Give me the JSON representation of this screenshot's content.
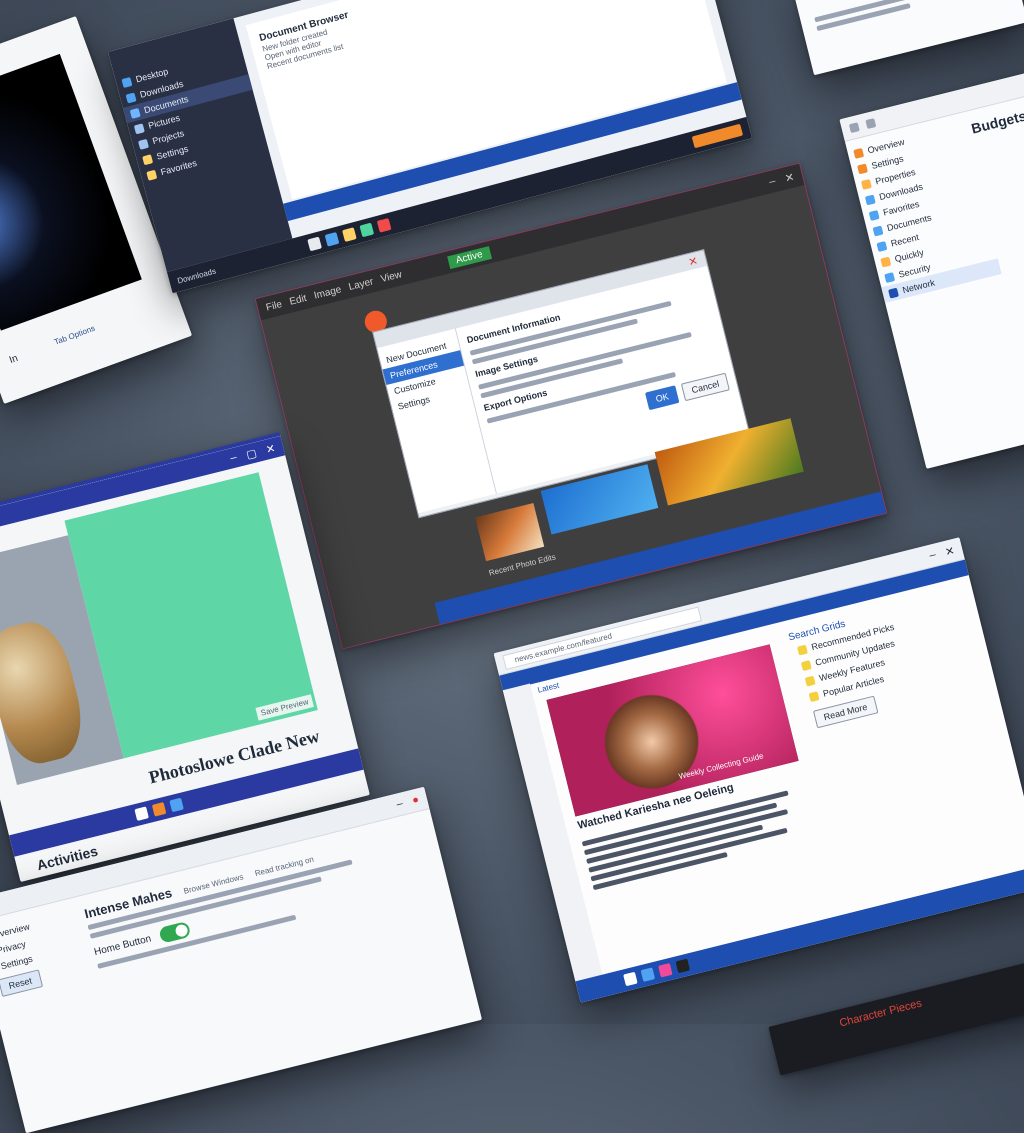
{
  "screen": {
    "background": "#4b5666"
  },
  "windows": {
    "space_viewer": {
      "status_left": "In",
      "status_right": "Tab Options"
    },
    "file_explorer": {
      "title": "Document Browser",
      "sidebar": [
        "Desktop",
        "Downloads",
        "Documents",
        "Pictures",
        "Projects",
        "Settings",
        "Favorites"
      ],
      "lines": [
        "New folder created",
        "Open with editor",
        "Recent documents list"
      ],
      "footer": "Downloads"
    },
    "settings_panel": {
      "title": "Budgets",
      "items": [
        "Overview",
        "Settings",
        "Properties",
        "Downloads",
        "Favorites",
        "Documents",
        "Recent",
        "Quickly",
        "Security",
        "Network"
      ]
    },
    "photo_editor": {
      "tabs": [
        "File",
        "Edit",
        "Image",
        "Layer",
        "View"
      ],
      "dialog": {
        "menu": [
          "New Document",
          "Preferences",
          "Customize",
          "Settings"
        ],
        "heading1": "Document Information",
        "heading2": "Image Settings",
        "heading3": "Export Options",
        "ok_label": "OK",
        "cancel_label": "Cancel"
      },
      "caption": "Recent Photo Edits",
      "green_tab": "Active"
    },
    "photos_app": {
      "title": "Photoslowe Clade New",
      "status": "Save Preview",
      "footer": "Activities"
    },
    "news_browser": {
      "url": "news.example.com/featured",
      "nav_label": "Latest",
      "article_title": "Watched Kariesha nee Oeleing",
      "caption": "Weekly Collecting Guide",
      "sidebar_heading": "Search Grids",
      "sidebar_items": [
        "Recommended Picks",
        "Community Updates",
        "Weekly Features",
        "Popular Articles"
      ],
      "sidebar_button": "Read More"
    },
    "settings_page": {
      "heading": "Intense Mahes",
      "sub_heading": "Browse Windows",
      "meta": "Read tracking on",
      "toggle_label": "Home Button",
      "toggle_on": true,
      "sidebar": [
        "Overview",
        "Privacy",
        "Settings"
      ],
      "button_label": "Reset"
    },
    "dark_strip": {
      "text": "Character Pieces"
    }
  },
  "colors": {
    "accent_blue": "#1e4fb0",
    "dark_chrome": "#232838",
    "green": "#4fd4a0",
    "orange": "#f08a2a"
  }
}
